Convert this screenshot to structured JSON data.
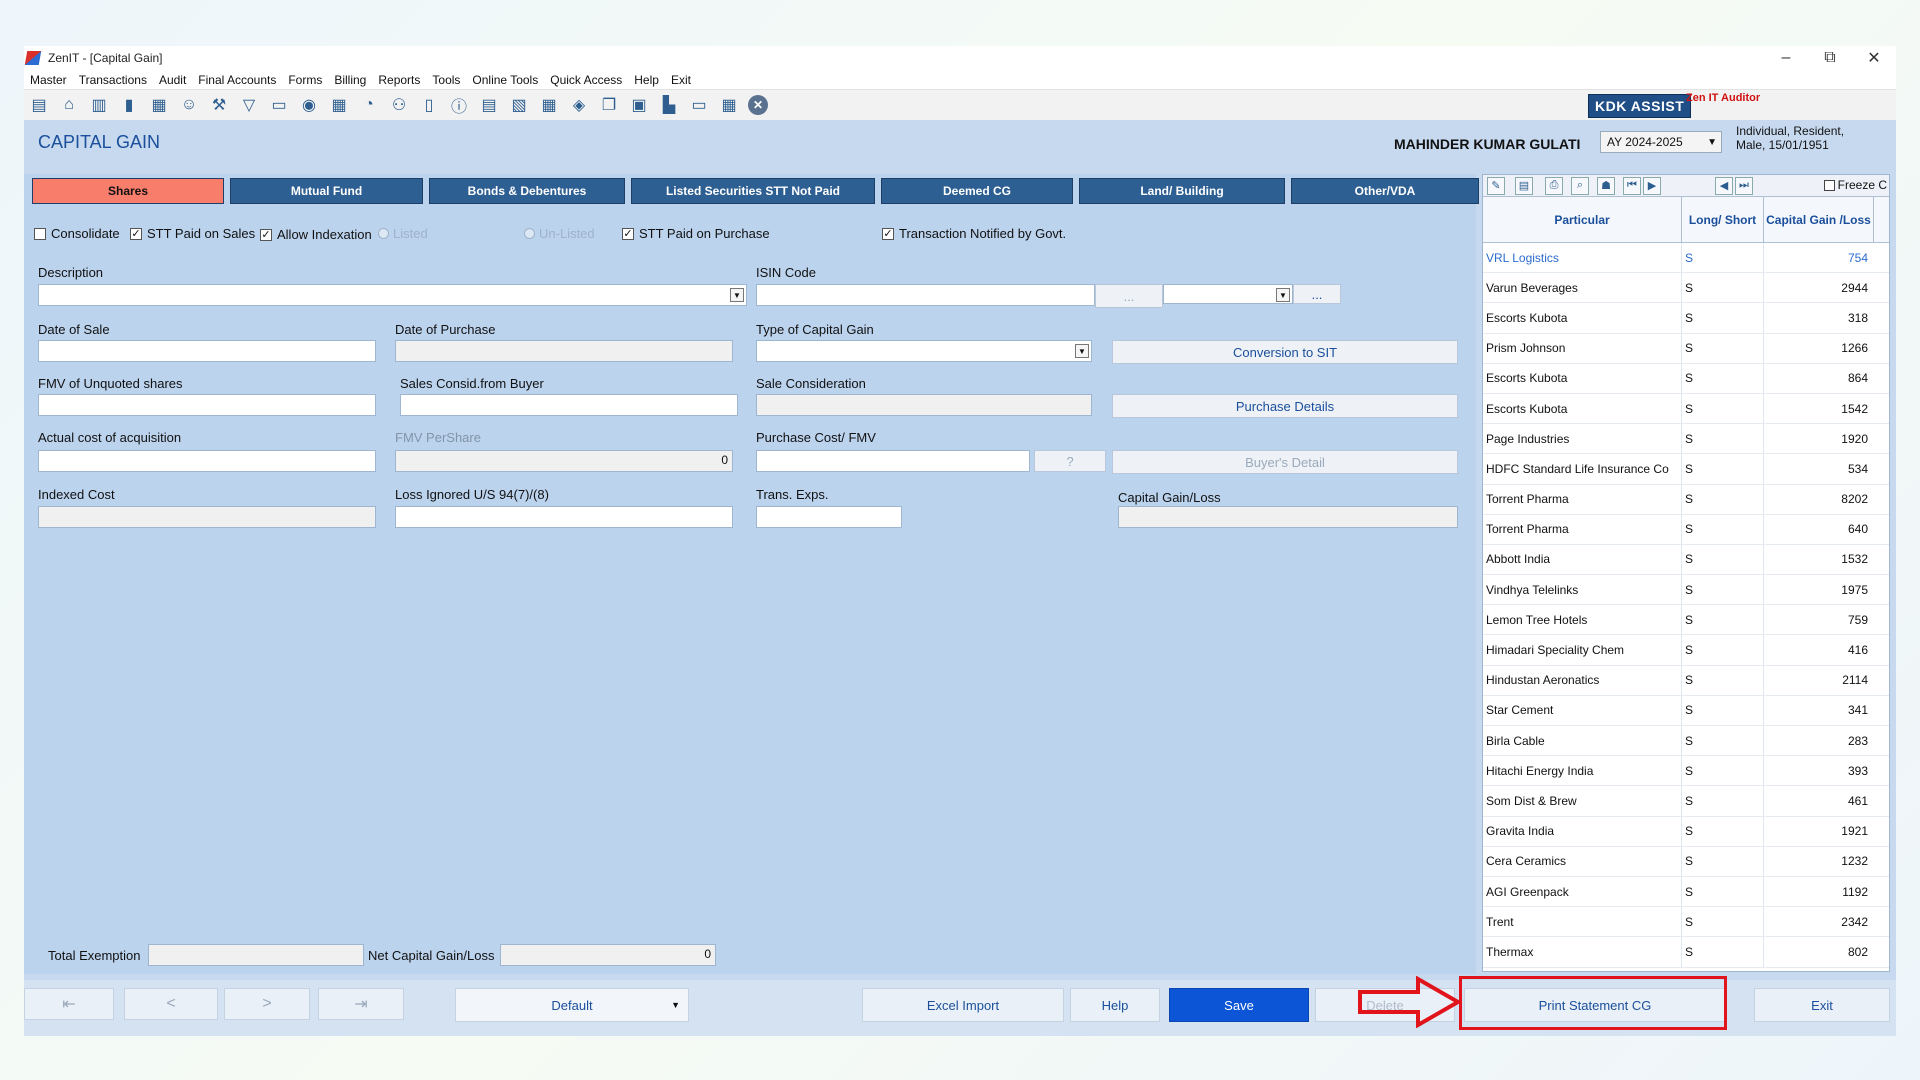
{
  "window": {
    "title": "ZenIT - [Capital Gain]",
    "controls": {
      "minimize": "–",
      "restore": "⧉",
      "close": "✕"
    }
  },
  "menu": [
    "Master",
    "Transactions",
    "Audit",
    "Final Accounts",
    "Forms",
    "Billing",
    "Reports",
    "Tools",
    "Online Tools",
    "Quick Access",
    "Help",
    "Exit"
  ],
  "toolbar": {
    "icons": [
      "book-icon",
      "home-icon",
      "building-icon",
      "chart-icon",
      "gift-icon",
      "people-icon",
      "hammer-icon",
      "filter-icon",
      "tax-icon",
      "rewind-icon",
      "calculator-icon",
      "pie-icon",
      "pay-icon",
      "tablet-icon",
      "info-icon",
      "form-icon",
      "doc-icon",
      "calendar-icon",
      "shield-icon",
      "copy-icon",
      "bs-icon",
      "person-icon",
      "sco-icon",
      "grid-icon",
      "close-icon"
    ],
    "kdk_label": "KDK ASSIST",
    "auditor_label": "Zen IT Auditor"
  },
  "header": {
    "page_title": "CAPITAL GAIN",
    "client_name": "MAHINDER KUMAR GULATI",
    "assessment_year": "AY 2024-2025",
    "client_info_line1": "Individual, Resident,",
    "client_info_line2": "Male, 15/01/1951"
  },
  "tabs": [
    "Shares",
    "Mutual Fund",
    "Bonds & Debentures",
    "Listed Securities STT Not Paid",
    "Deemed CG",
    "Land/ Building",
    "Other/VDA"
  ],
  "options": {
    "consolidate": "Consolidate",
    "stt_sales": "STT Paid on Sales",
    "indexation": "Allow Indexation",
    "listed": "Listed",
    "unlisted": "Un-Listed",
    "stt_purchase": "STT Paid on Purchase",
    "notified": "Transaction Notified by Govt."
  },
  "form": {
    "description_label": "Description",
    "isin_label": "ISIN Code",
    "date_sale_label": "Date of Sale",
    "date_purchase_label": "Date of Purchase",
    "type_cg_label": "Type of Capital Gain",
    "fmv_unquoted_label": "FMV of Unquoted shares",
    "sales_consid_buyer_label": "Sales Consid.from Buyer",
    "sale_consideration_label": "Sale Consideration",
    "actual_cost_label": "Actual cost of acquisition",
    "fmv_pershare_label": "FMV PerShare",
    "fmv_pershare_value": "0",
    "purchase_cost_label": "Purchase Cost/ FMV",
    "indexed_cost_label": "Indexed Cost",
    "loss_ignored_label": "Loss Ignored U/S 94(7)/(8)",
    "trans_exps_label": "Trans. Exps.",
    "capital_gain_loss_label": "Capital Gain/Loss",
    "total_exemption_label": "Total Exemption",
    "net_cg_label": "Net Capital Gain/Loss",
    "net_cg_value": "0",
    "conversion_btn": "Conversion to SIT",
    "purchase_details_btn": "Purchase Details",
    "buyers_detail_btn": "Buyer's Detail",
    "ellipsis": "...",
    "question": "?"
  },
  "grid": {
    "freeze_label": "Freeze C",
    "headers": [
      "Particular",
      "Long/ Short",
      "Capital Gain /Loss"
    ],
    "rows": [
      {
        "name": "VRL Logistics",
        "ls": "S",
        "amount": "754"
      },
      {
        "name": "Varun Beverages",
        "ls": "S",
        "amount": "2944"
      },
      {
        "name": "Escorts Kubota",
        "ls": "S",
        "amount": "318"
      },
      {
        "name": "Prism Johnson",
        "ls": "S",
        "amount": "1266"
      },
      {
        "name": "Escorts Kubota",
        "ls": "S",
        "amount": "864"
      },
      {
        "name": "Escorts Kubota",
        "ls": "S",
        "amount": "1542"
      },
      {
        "name": "Page Industries",
        "ls": "S",
        "amount": "1920"
      },
      {
        "name": "HDFC Standard Life Insurance Co",
        "ls": "S",
        "amount": "534"
      },
      {
        "name": "Torrent Pharma",
        "ls": "S",
        "amount": "8202"
      },
      {
        "name": "Torrent Pharma",
        "ls": "S",
        "amount": "640"
      },
      {
        "name": "Abbott India",
        "ls": "S",
        "amount": "1532"
      },
      {
        "name": "Vindhya Telelinks",
        "ls": "S",
        "amount": "1975"
      },
      {
        "name": "Lemon Tree Hotels",
        "ls": "S",
        "amount": "759"
      },
      {
        "name": "Himadari Speciality Chem",
        "ls": "S",
        "amount": "416"
      },
      {
        "name": "Hindustan Aeronatics",
        "ls": "S",
        "amount": "2114"
      },
      {
        "name": "Star Cement",
        "ls": "S",
        "amount": "341"
      },
      {
        "name": "Birla Cable",
        "ls": "S",
        "amount": "283"
      },
      {
        "name": "Hitachi Energy India",
        "ls": "S",
        "amount": "393"
      },
      {
        "name": "Som Dist & Brew",
        "ls": "S",
        "amount": "461"
      },
      {
        "name": "Gravita India",
        "ls": "S",
        "amount": "1921"
      },
      {
        "name": "Cera Ceramics",
        "ls": "S",
        "amount": "1232"
      },
      {
        "name": "AGI Greenpack",
        "ls": "S",
        "amount": "1192"
      },
      {
        "name": "Trent",
        "ls": "S",
        "amount": "2342"
      },
      {
        "name": "Thermax",
        "ls": "S",
        "amount": "802"
      }
    ]
  },
  "bottom": {
    "first": "⇤",
    "prev": "<",
    "next": ">",
    "last": "⇥",
    "default_select": "Default",
    "excel_import": "Excel Import",
    "help": "Help",
    "save": "Save",
    "delete": "Delete",
    "print_statement": "Print Statement CG",
    "exit": "Exit"
  },
  "colors": {
    "accent": "#1a4f9c",
    "active_tab": "#f87d6b",
    "tab": "#2e5f92",
    "save": "#0b55d6",
    "highlight": "#e0141a"
  }
}
